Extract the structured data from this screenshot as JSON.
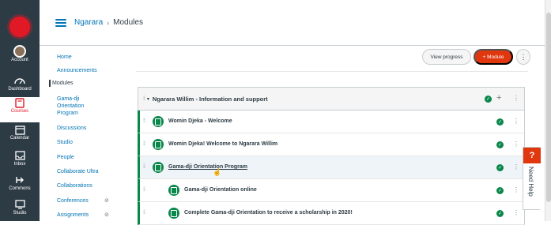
{
  "global_nav": {
    "items": [
      {
        "label": "Account",
        "icon": "account-avatar-icon"
      },
      {
        "label": "Dashboard",
        "icon": "dashboard-icon"
      },
      {
        "label": "Courses",
        "icon": "courses-book-icon",
        "active": true
      },
      {
        "label": "Calendar",
        "icon": "calendar-icon"
      },
      {
        "label": "Inbox",
        "icon": "inbox-icon"
      },
      {
        "label": "Commons",
        "icon": "commons-arrow-icon"
      },
      {
        "label": "Studio",
        "icon": "studio-icon"
      }
    ]
  },
  "breadcrumb": {
    "course": "Ngarara",
    "separator": "›",
    "current": "Modules"
  },
  "course_nav": {
    "items": [
      {
        "label": "Home"
      },
      {
        "label": "Announcements"
      },
      {
        "label": "Modules",
        "active": true
      },
      {
        "label": "Gama-dji Orientation Program"
      },
      {
        "label": "Discussions"
      },
      {
        "label": "Studio"
      },
      {
        "label": "People"
      },
      {
        "label": "Collaborate Ultra"
      },
      {
        "label": "Collaborations"
      },
      {
        "label": "Conferences",
        "hidden_icon": "eye-slash-icon"
      },
      {
        "label": "Assignments",
        "hidden_icon": "eye-slash-icon"
      }
    ]
  },
  "toolbar": {
    "view_progress": "View progress",
    "add_module": "+ Module",
    "more": "⋮"
  },
  "module": {
    "title": "Ngarara Willim - Information and support",
    "items": [
      {
        "title": "Womin Djeka - Welcome",
        "indent": 0
      },
      {
        "title": "Womin Djeka! Welcome to Ngarara Willim",
        "indent": 0
      },
      {
        "title": "Gama-dji Orientation Program",
        "indent": 0,
        "link": true
      },
      {
        "title": "Gama-dji Orientation online",
        "indent": 1
      },
      {
        "title": "Complete Gama-dji Orientation to receive a scholarship in 2020!",
        "indent": 1
      }
    ]
  },
  "help": {
    "icon": "?",
    "label": "Need Help"
  },
  "colors": {
    "nav_bg": "#2d3b45",
    "brand_red": "#e11926",
    "link_blue": "#0374b5",
    "success_green": "#0b874b",
    "button_orange": "#e0370f"
  }
}
